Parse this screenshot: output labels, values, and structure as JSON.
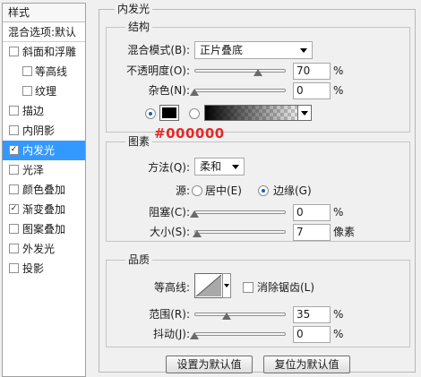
{
  "sidebar": {
    "header": "样式",
    "blend_options": "混合选项:默认",
    "items": [
      {
        "label": "斜面和浮雕",
        "checked": false
      },
      {
        "label": "等高线",
        "checked": false
      },
      {
        "label": "纹理",
        "checked": false
      },
      {
        "label": "描边",
        "checked": false
      },
      {
        "label": "内阴影",
        "checked": false
      },
      {
        "label": "内发光",
        "checked": true,
        "selected": true
      },
      {
        "label": "光泽",
        "checked": false
      },
      {
        "label": "颜色叠加",
        "checked": false
      },
      {
        "label": "渐变叠加",
        "checked": true
      },
      {
        "label": "图案叠加",
        "checked": false
      },
      {
        "label": "外发光",
        "checked": false
      },
      {
        "label": "投影",
        "checked": false
      }
    ],
    "check_mark": "✓"
  },
  "panel": {
    "title": "内发光"
  },
  "structure": {
    "title": "结构",
    "blend_mode_label": "混合模式(B):",
    "blend_mode_value": "正片叠底",
    "opacity_label": "不透明度(O):",
    "opacity_value": "70",
    "opacity_percent": 70,
    "noise_label": "杂色(N):",
    "noise_value": "0",
    "noise_percent": 0,
    "unit": "%",
    "color_hex_note": "#000000",
    "glow_color": "#000000"
  },
  "elements": {
    "title": "图素",
    "method_label": "方法(Q):",
    "method_value": "柔和",
    "source_label": "源:",
    "source_center": "居中(E)",
    "source_edge": "边缘(G)",
    "choke_label": "阻塞(C):",
    "choke_value": "0",
    "choke_percent": 0,
    "size_label": "大小(S):",
    "size_value": "7",
    "size_fraction": 0.028,
    "size_unit": "像素",
    "unit": "%"
  },
  "quality": {
    "title": "品质",
    "contour_label": "等高线:",
    "anti_alias_label": "消除锯齿(L)",
    "range_label": "范围(R):",
    "range_value": "35",
    "range_percent": 35,
    "jitter_label": "抖动(J):",
    "jitter_value": "0",
    "jitter_percent": 0,
    "unit": "%"
  },
  "buttons": {
    "set_default": "设置为默认值",
    "reset_default": "复位为默认值"
  },
  "colors": {
    "selection": "#3399ff",
    "note": "#e42828"
  }
}
